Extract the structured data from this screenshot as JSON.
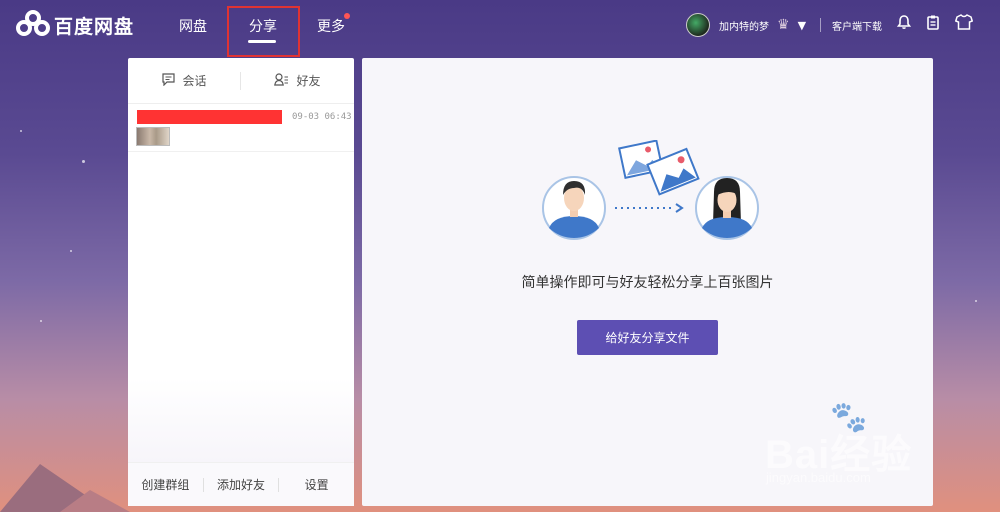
{
  "app": {
    "logo_text": "百度网盘"
  },
  "nav": {
    "items": [
      "网盘",
      "分享",
      "更多"
    ],
    "active": "分享"
  },
  "user": {
    "name": "加内特的梦"
  },
  "header": {
    "client_download": "客户端下载"
  },
  "left_panel": {
    "tabs": [
      {
        "label": "会话",
        "icon": "chat-icon"
      },
      {
        "label": "好友",
        "icon": "friends-icon"
      }
    ],
    "conversations": [
      {
        "time": "09-03 06:43"
      }
    ],
    "footer": [
      "创建群组",
      "添加好友",
      "设置"
    ]
  },
  "main": {
    "message": "简单操作即可与好友轻松分享上百张图片",
    "button_label": "给好友分享文件"
  },
  "watermark": {
    "text": "Bai经验",
    "sub": "jingyan.baidu.com"
  },
  "colors": {
    "accent": "#5d4fb3",
    "highlight_box": "#e03333"
  }
}
